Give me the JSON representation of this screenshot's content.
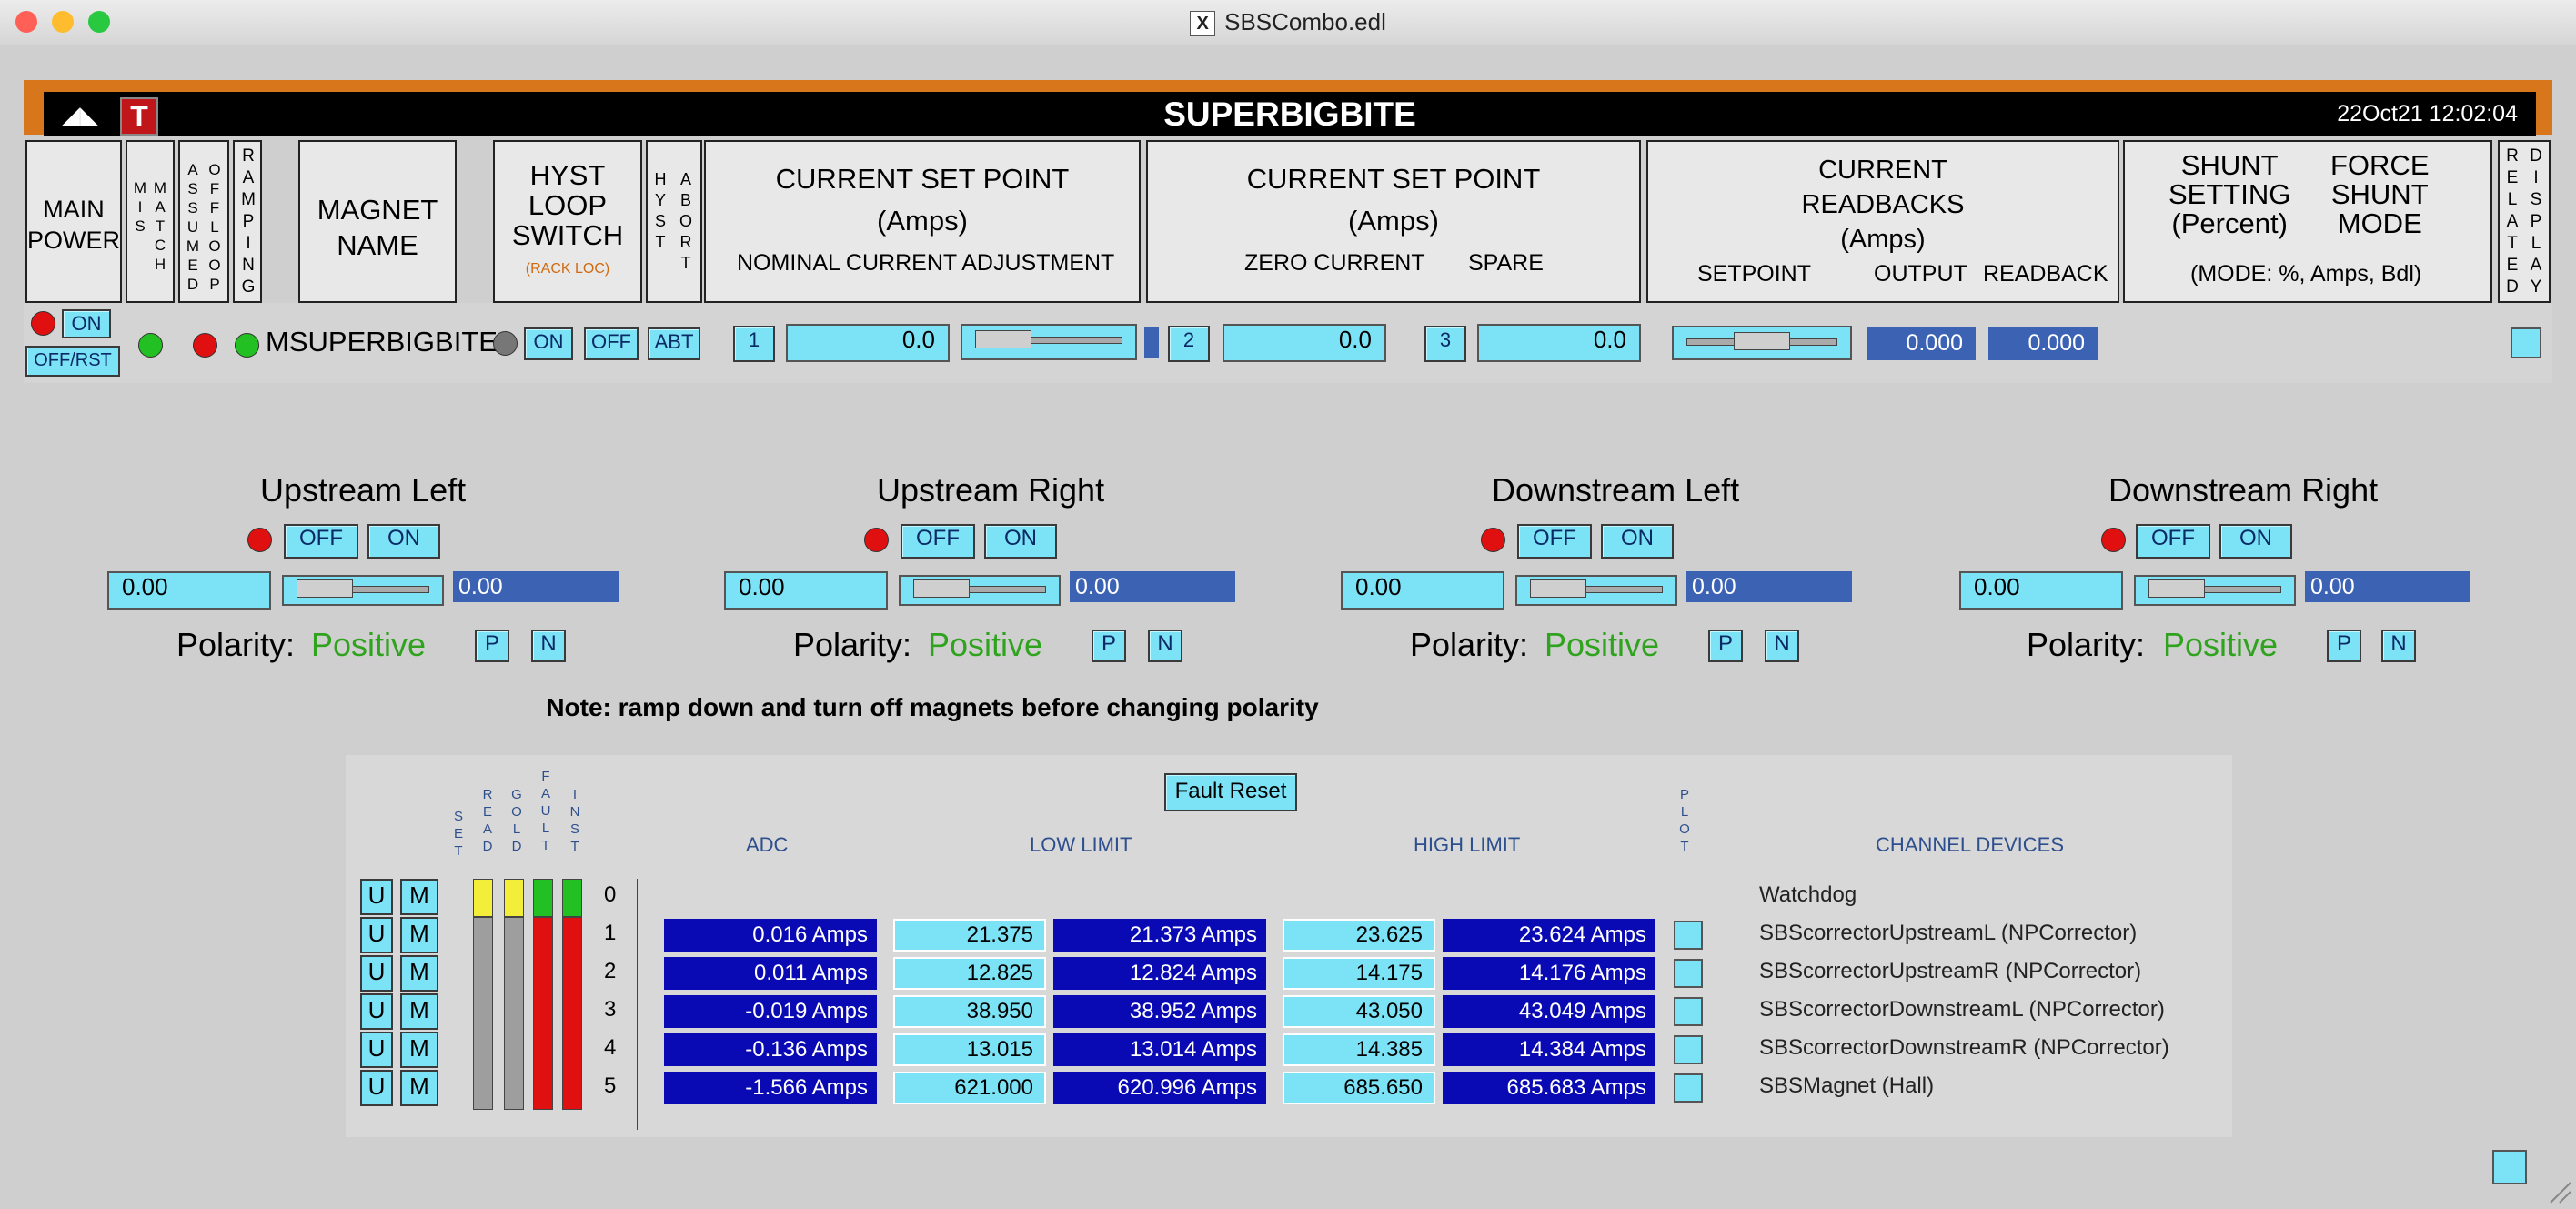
{
  "window": {
    "title": "SBSCombo.edl",
    "traffic_colors": [
      "#fe5f57",
      "#febc2e",
      "#28c840"
    ]
  },
  "banner": {
    "title": "SUPERBIGBITE",
    "datetime": "22Oct21 12:02:04",
    "logo_letter": "T"
  },
  "header": {
    "main_power": "MAIN\nPOWER",
    "mismatch": "MIS\nMATCH",
    "assumed": "ASSUMED",
    "offloop": "OFFLOOP",
    "ramping": "RAMPING",
    "magnet_name": "MAGNET\nNAME",
    "hyst_switch": "HYST\nLOOP\nSWITCH",
    "rack_loc": "(RACK LOC)",
    "hyst": "HYST",
    "abort": "ABORT",
    "csp1_title": "CURRENT SET POINT",
    "csp1_units": "(Amps)",
    "csp1_sub": "NOMINAL  CURRENT  ADJUSTMENT",
    "csp2_title": "CURRENT SET POINT",
    "csp2_units": "(Amps)",
    "csp2_sub1": "ZERO CURRENT",
    "csp2_sub2": "SPARE",
    "rb_title": "CURRENT\nREADBACKS\n(Amps)",
    "rb_sub1": "SETPOINT",
    "rb_sub2": "OUTPUT",
    "rb_sub3": "READBACK",
    "shunt": "SHUNT\nSETTING\n(Percent)",
    "force": "FORCE\nSHUNT\nMODE",
    "mode_note": "(MODE: %, Amps, Bdl)",
    "related": "RELATED",
    "display": "DISPLAY"
  },
  "magnet_row": {
    "on": "ON",
    "off_rst": "OFF/RST",
    "name": "MSUPERBIGBITE",
    "hyst_on": "ON",
    "hyst_off": "OFF",
    "abt": "ABT",
    "sp1_btn": "1",
    "sp1_val": "0.0",
    "sp2_btn": "2",
    "sp2_val": "0.0",
    "sp3_btn": "3",
    "sp3_val": "0.0",
    "output": "0.000",
    "readback": "0.000"
  },
  "magnets": [
    {
      "name": "Upstream Left",
      "off": "OFF",
      "on": "ON",
      "setpoint": "0.00",
      "readback": "0.00",
      "polarity_label": "Polarity:",
      "polarity": "Positive",
      "p": "P",
      "n": "N"
    },
    {
      "name": "Upstream Right",
      "off": "OFF",
      "on": "ON",
      "setpoint": "0.00",
      "readback": "0.00",
      "polarity_label": "Polarity:",
      "polarity": "Positive",
      "p": "P",
      "n": "N"
    },
    {
      "name": "Downstream Left",
      "off": "OFF",
      "on": "ON",
      "setpoint": "0.00",
      "readback": "0.00",
      "polarity_label": "Polarity:",
      "polarity": "Positive",
      "p": "P",
      "n": "N"
    },
    {
      "name": "Downstream Right",
      "off": "OFF",
      "on": "ON",
      "setpoint": "0.00",
      "readback": "0.00",
      "polarity_label": "Polarity:",
      "polarity": "Positive",
      "p": "P",
      "n": "N"
    }
  ],
  "note": "Note: ramp down and turn off magnets before changing polarity",
  "table": {
    "fault_reset": "Fault Reset",
    "vcols": [
      "SET",
      "READ",
      "GOLD",
      "FAULT",
      "INST",
      "PLOT"
    ],
    "headers": {
      "adc": "ADC",
      "low": "LOW LIMIT",
      "high": "HIGH LIMIT",
      "devices": "CHANNEL DEVICES"
    },
    "u_label": "U",
    "m_label": "M",
    "row0": {
      "num": "0",
      "device": "Watchdog"
    },
    "rows": [
      {
        "num": "1",
        "adc": "0.016 Amps",
        "low_set": "21.375",
        "low_rb": "21.373 Amps",
        "high_set": "23.625",
        "high_rb": "23.624 Amps",
        "device": "SBScorrectorUpstreamL (NPCorrector)"
      },
      {
        "num": "2",
        "adc": "0.011 Amps",
        "low_set": "12.825",
        "low_rb": "12.824 Amps",
        "high_set": "14.175",
        "high_rb": "14.176 Amps",
        "device": "SBScorrectorUpstreamR (NPCorrector)"
      },
      {
        "num": "3",
        "adc": "-0.019 Amps",
        "low_set": "38.950",
        "low_rb": "38.952 Amps",
        "high_set": "43.050",
        "high_rb": "43.049 Amps",
        "device": "SBScorrectorDownstreamL (NPCorrector)"
      },
      {
        "num": "4",
        "adc": "-0.136 Amps",
        "low_set": "13.015",
        "low_rb": "13.014 Amps",
        "high_set": "14.385",
        "high_rb": "14.384 Amps",
        "device": "SBScorrectorDownstreamR (NPCorrector)"
      },
      {
        "num": "5",
        "adc": "-1.566 Amps",
        "low_set": "621.000",
        "low_rb": "620.996 Amps",
        "high_set": "685.650",
        "high_rb": "685.683 Amps",
        "device": "SBSMagnet (Hall)"
      }
    ]
  },
  "colors": {
    "accent_orange": "#d8761c",
    "control_cyan": "#7ce2f6",
    "readout_blue": "#0a0ab4",
    "status_green": "#22c022",
    "status_red": "#e01010",
    "status_yellow": "#f2ee3a"
  }
}
